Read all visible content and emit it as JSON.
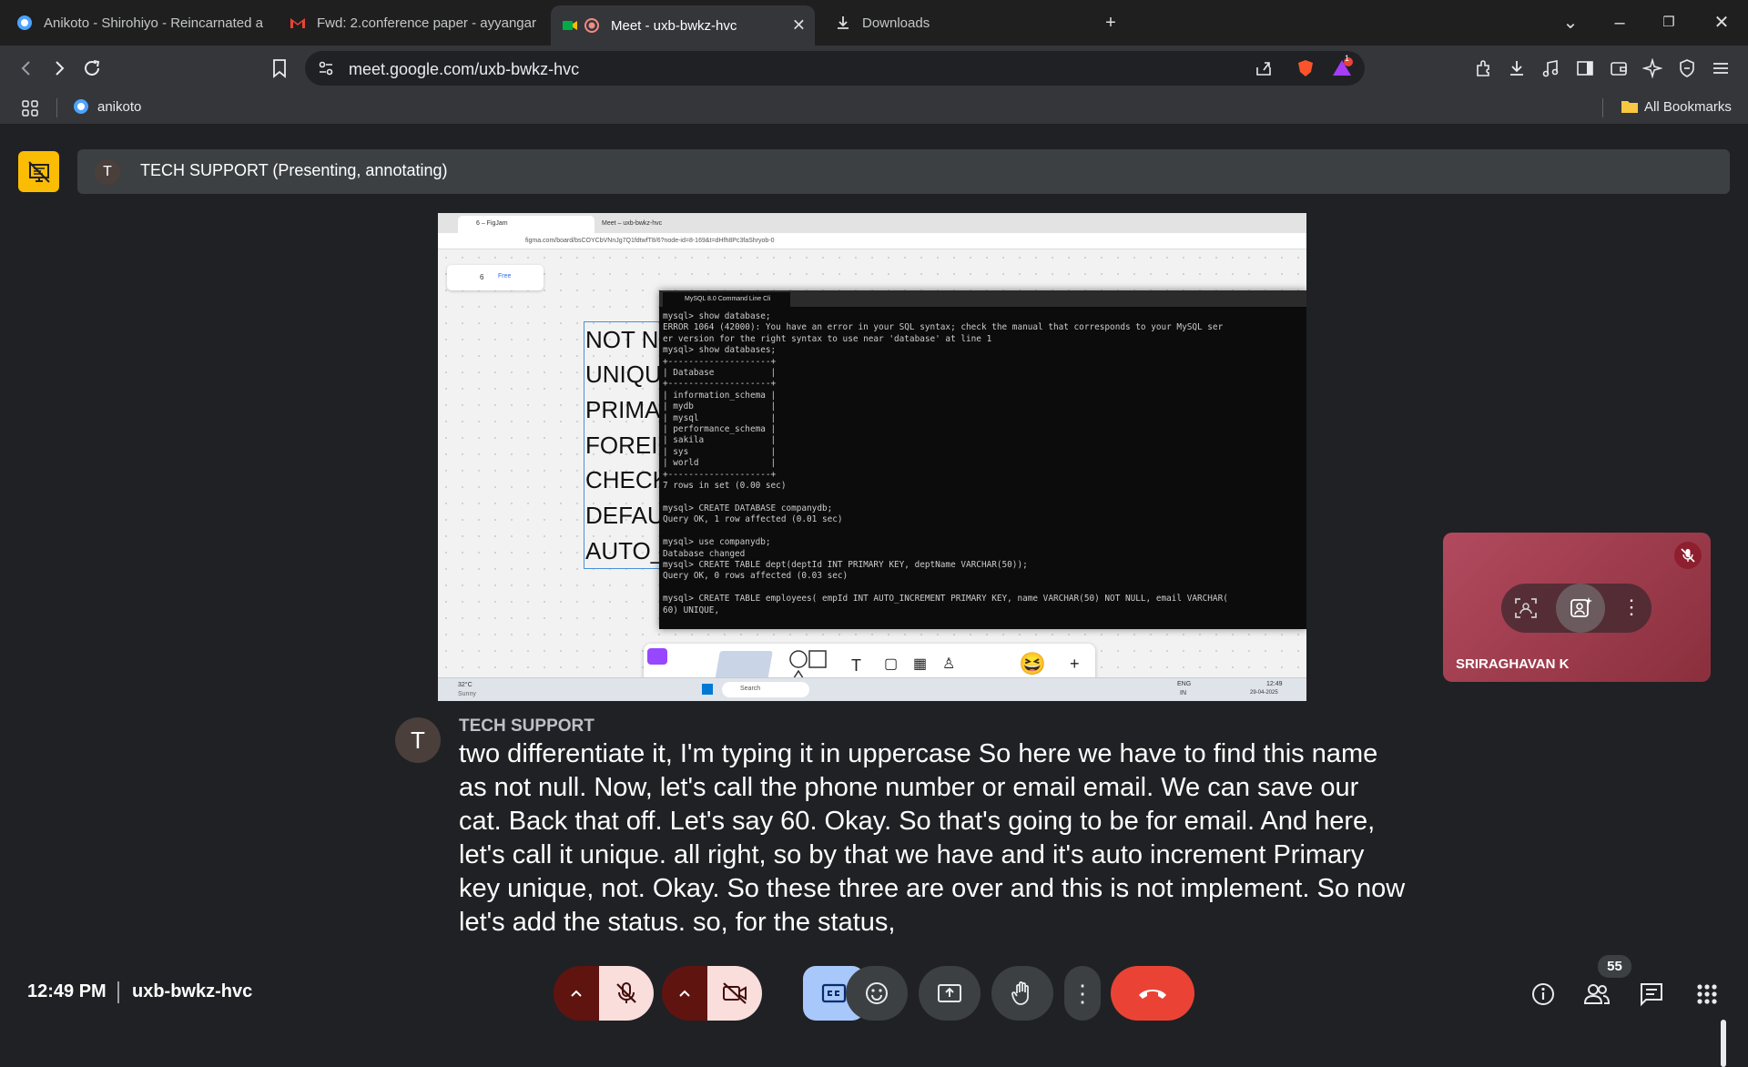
{
  "browser": {
    "tabs": [
      {
        "label": "Anikoto - Shirohiyo - Reincarnated a",
        "icon": "anikoto-icon"
      },
      {
        "label": "Fwd: 2.conference paper - ayyangar",
        "icon": "gmail-icon"
      },
      {
        "label": "Meet - uxb-bwkz-hvc",
        "icon": "google-meet-icon",
        "active": true
      },
      {
        "label": "Downloads",
        "icon": "download-icon"
      }
    ],
    "url": "meet.google.com/uxb-bwkz-hvc",
    "notification_count": "1",
    "bookmarks": {
      "item": "anikoto",
      "all_bookmarks": "All Bookmarks"
    }
  },
  "meet": {
    "presenter_initial": "T",
    "presenter_status": "TECH SUPPORT (Presenting, annotating)",
    "shared_screen": {
      "tabs": [
        "6 – FigJam",
        "Meet – uxb-bwkz-hvc"
      ],
      "url": "figma.com/board/bsCOYCbVNnJg7Q1fdtwfT8/6?node-id=8-169&t=dHfh8Pc3faShryob-0",
      "figjam_zoom": "6",
      "figjam_plan": "Free",
      "figjam_words": [
        "NOT N",
        "UNIQU",
        "PRIMA",
        "FOREIG",
        "CHECK",
        "DEFAU",
        "AUTO_"
      ],
      "terminal_title": "MySQL 8.0 Command Line Cli",
      "terminal_lines": [
        "mysql> show database;",
        "ERROR 1064 (42000): You have an error in your SQL syntax; check the manual that corresponds to your MySQL ser",
        "er version for the right syntax to use near 'database' at line 1",
        "mysql> show databases;",
        "+--------------------+",
        "| Database           |",
        "+--------------------+",
        "| information_schema |",
        "| mydb               |",
        "| mysql              |",
        "| performance_schema |",
        "| sakila             |",
        "| sys                |",
        "| world              |",
        "+--------------------+",
        "7 rows in set (0.00 sec)",
        "",
        "mysql> CREATE DATABASE companydb;",
        "Query OK, 1 row affected (0.01 sec)",
        "",
        "mysql> use companydb;",
        "Database changed",
        "mysql> CREATE TABLE dept(deptId INT PRIMARY KEY, deptName VARCHAR(50));",
        "Query OK, 0 rows affected (0.03 sec)",
        "",
        "mysql> CREATE TABLE employees( empId INT AUTO_INCREMENT PRIMARY KEY, name VARCHAR(50) NOT NULL, email VARCHAR(",
        "60) UNIQUE,"
      ],
      "weather_temp": "32°C",
      "weather_desc": "Sunny",
      "taskbar_search": "Search",
      "lang": "ENG",
      "lang_region": "IN",
      "tray_time": "12:49",
      "tray_date": "29-04-2025"
    },
    "self_tile": {
      "name": "SRIRAGHAVAN K"
    },
    "caption": {
      "speaker_initial": "T",
      "speaker": "TECH SUPPORT",
      "text": "two differentiate it, I'm typing it in uppercase So here we have to find this name as not null. Now, let's call the phone number or email email. We can save our cat. Back that off. Let's say 60. Okay. So that's going to be for email. And here, let's call it unique. all right, so by that we have and it's auto increment Primary key unique, not. Okay. So these three are over and this is not implement. So now let's add the status. so, for the status,"
    },
    "bottom": {
      "time": "12:49 PM",
      "meeting_code": "uxb-bwkz-hvc",
      "participant_count": "55"
    },
    "colors": {
      "end_call": "#ea4335",
      "present_badge": "#fbbc04",
      "captions_on": "#a8c7fa",
      "off_state": "#f9dedc"
    }
  }
}
